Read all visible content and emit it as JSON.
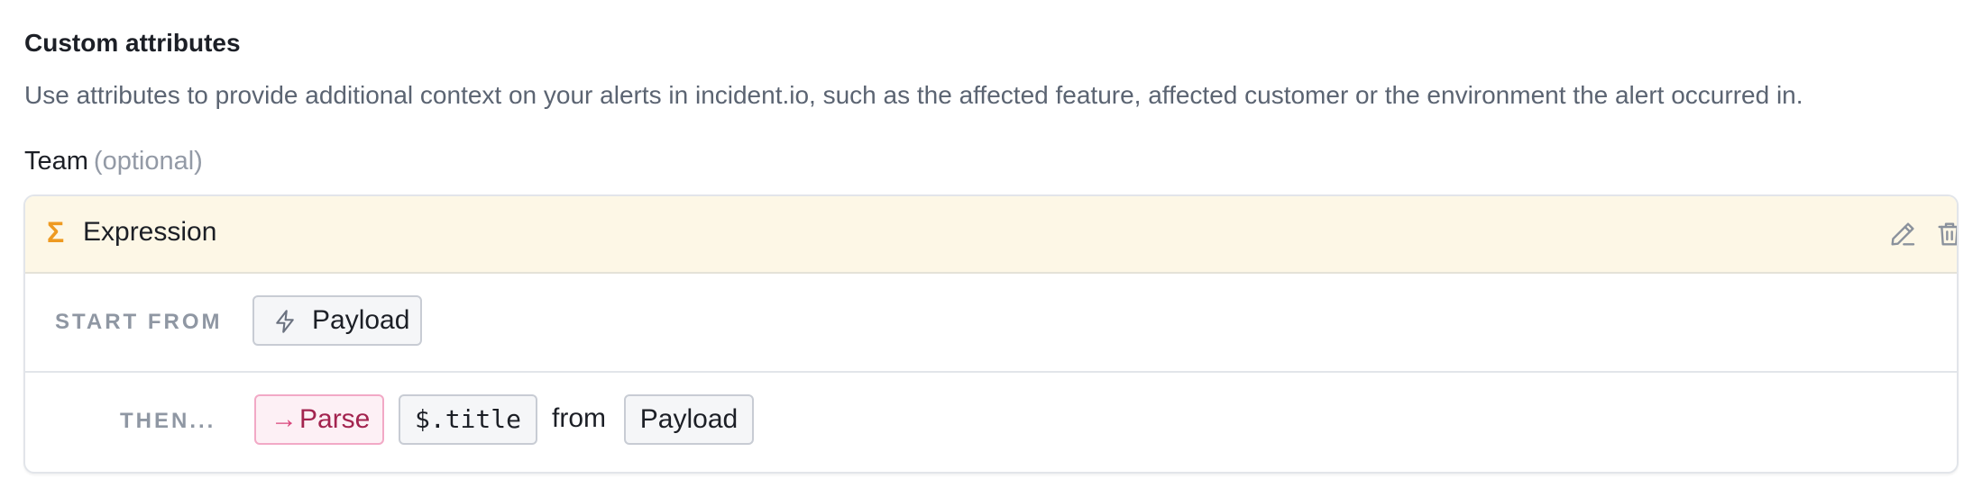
{
  "section": {
    "title": "Custom attributes",
    "description": "Use attributes to provide additional context on your alerts in incident.io, such as the affected feature, affected customer or the environment the alert occurred in."
  },
  "field": {
    "label": "Team",
    "optional_label": "(optional)"
  },
  "expression": {
    "header_icon": "sigma-icon",
    "title": "Expression",
    "actions": [
      "edit-icon",
      "trash-icon"
    ],
    "start_from": {
      "label": "START FROM",
      "source_icon": "bolt-icon",
      "source": "Payload"
    },
    "then": {
      "label": "THEN...",
      "operation_icon": "arrow-right-icon",
      "operation": "Parse",
      "path": "$.title",
      "connector": "from",
      "target": "Payload"
    }
  },
  "colors": {
    "header_bg": "#fdf7e6",
    "sigma": "#ee9a21",
    "parse_bg": "#fdf0f5",
    "parse_border": "#f2a9c6",
    "parse_text": "#a3244f"
  }
}
